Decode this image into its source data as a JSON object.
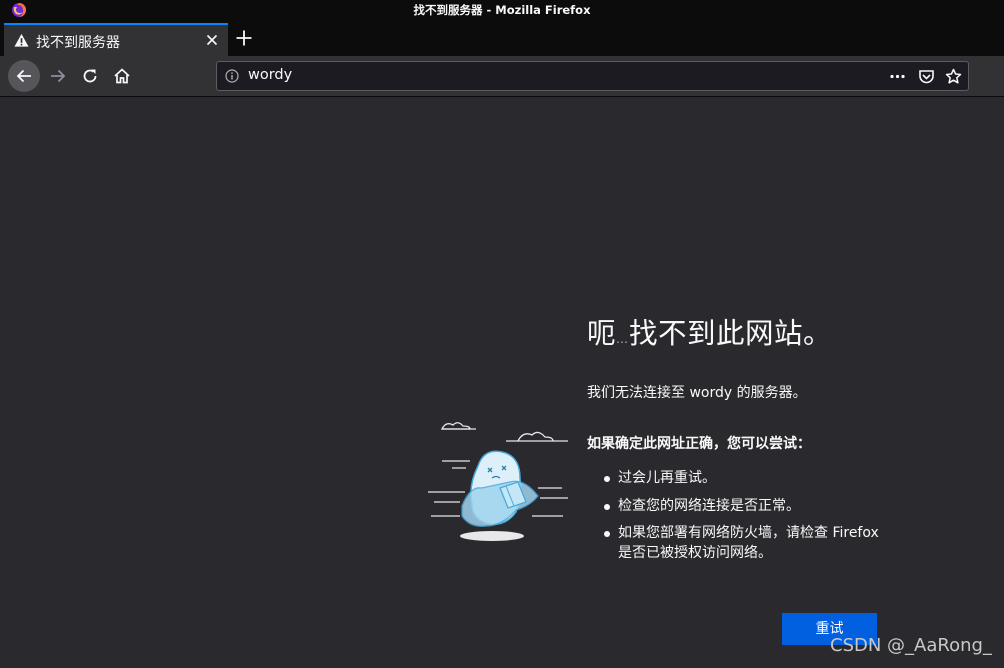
{
  "window": {
    "title": "找不到服务器 - Mozilla Firefox",
    "logo_icon": "firefox-logo"
  },
  "tab": {
    "label": "找不到服务器",
    "icon": "warning-icon",
    "close_icon": "close-icon",
    "accent": "#0a84ff"
  },
  "toolbar": {
    "back_icon": "arrow-left-icon",
    "forward_icon": "arrow-right-icon",
    "reload_icon": "reload-icon",
    "home_icon": "home-icon",
    "url": "wordy",
    "page_actions_icon": "more-horizontal-icon",
    "pocket_icon": "pocket-icon",
    "bookmark_icon": "star-icon"
  },
  "error_page": {
    "title_main": "呃",
    "title_dots": "…",
    "title_rest": "找不到此网站。",
    "description": "我们无法连接至 wordy 的服务器。",
    "suggestion_heading": "如果确定此网址正确，您可以尝试：",
    "suggestions": [
      "过会儿再重试。",
      "检查您的网络连接是否正常。",
      "如果您部署有网络防火墙，请检查 Firefox 是否已被授权访问网络。"
    ],
    "retry_label": "重试",
    "retry_color": "#0060df",
    "illustration": "lost-character-illustration"
  },
  "watermark": "CSDN @_AaRong_"
}
